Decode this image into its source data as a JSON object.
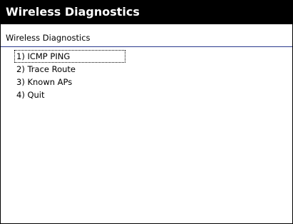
{
  "window": {
    "title": "Wireless Diagnostics"
  },
  "header": {
    "label": "Wireless Diagnostics"
  },
  "menu": {
    "items": [
      {
        "label": "1) ICMP PING",
        "focused": true
      },
      {
        "label": "2) Trace Route",
        "focused": false
      },
      {
        "label": "3) Known APs",
        "focused": false
      },
      {
        "label": "4) Quit",
        "focused": false
      }
    ]
  }
}
